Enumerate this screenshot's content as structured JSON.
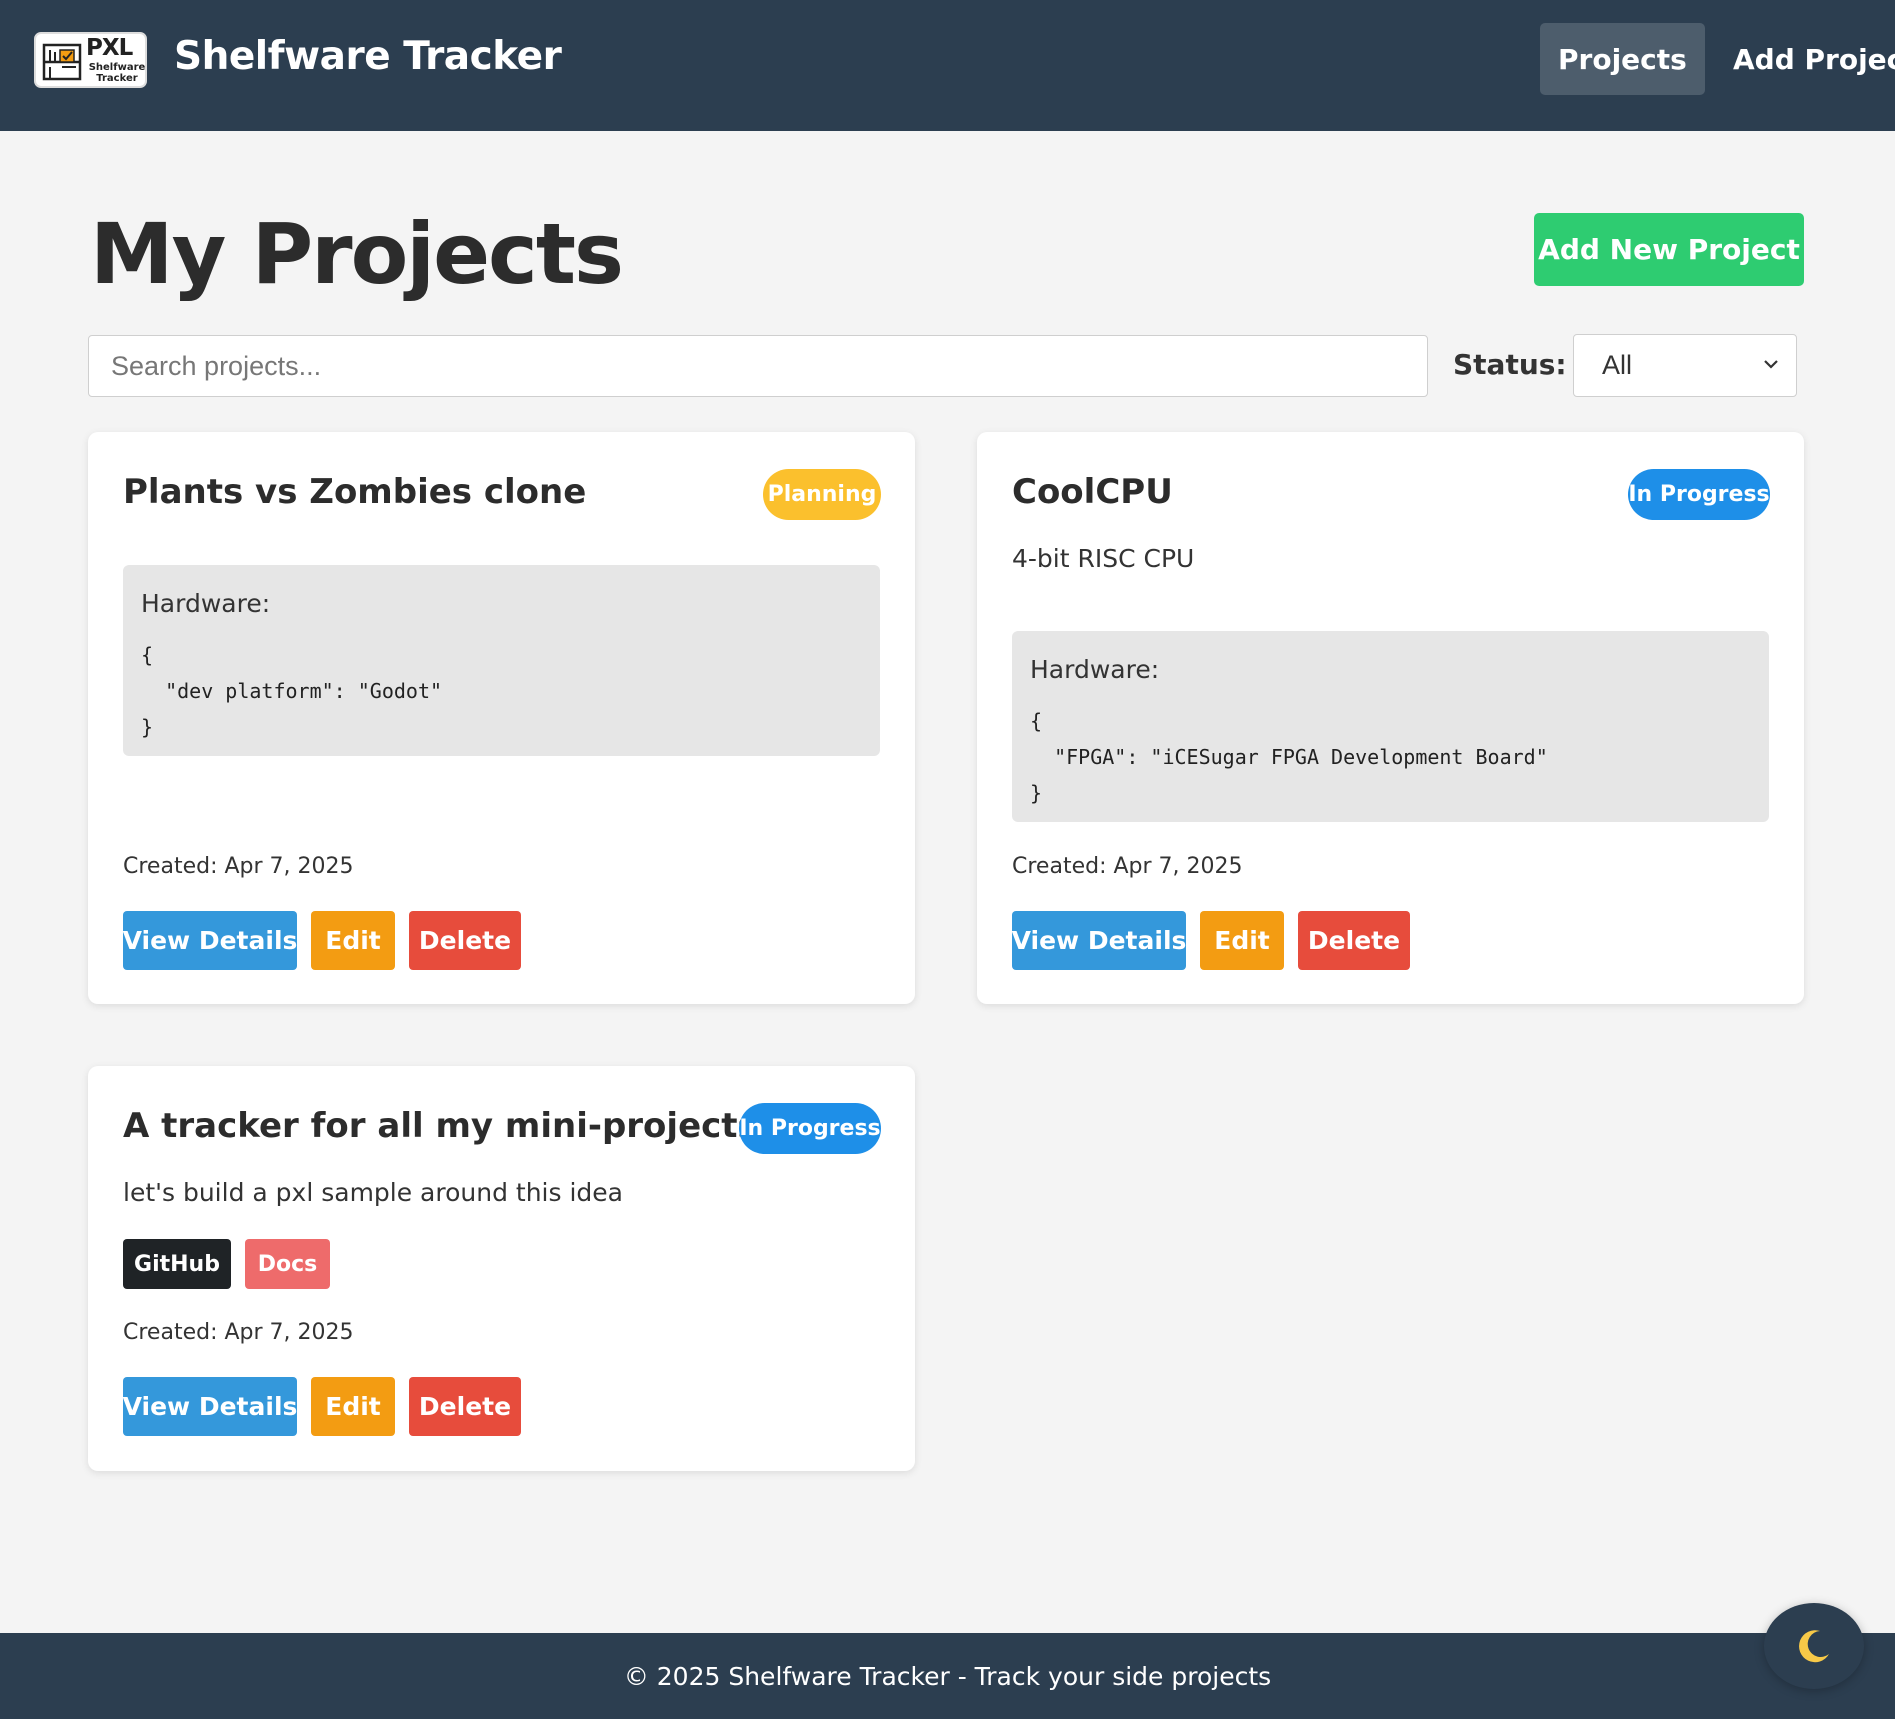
{
  "header": {
    "logo_text": "PXL",
    "logo_subtext_1": "Shelfware",
    "logo_subtext_2": "Tracker",
    "app_title": "Shelfware Tracker",
    "nav": [
      {
        "label": "Projects",
        "active": true
      },
      {
        "label": "Add Project",
        "active": false
      }
    ]
  },
  "main": {
    "title": "My Projects",
    "add_button": "Add New Project",
    "search_placeholder": "Search projects...",
    "status_label": "Status:",
    "status_selected": "All"
  },
  "projects": [
    {
      "title": "Plants vs Zombies clone",
      "status": "Planning",
      "status_color": "#fbc02d",
      "description": "",
      "hardware_label": "Hardware:",
      "hardware_code": "{\n  \"dev platform\": \"Godot\"\n}",
      "created": "Created: Apr 7, 2025",
      "buttons": {
        "view": "View Details",
        "edit": "Edit",
        "delete": "Delete"
      }
    },
    {
      "title": "CoolCPU",
      "status": "In Progress",
      "status_color": "#1e8fe8",
      "description": "4-bit RISC CPU",
      "hardware_label": "Hardware:",
      "hardware_code": "{\n  \"FPGA\": \"iCESugar FPGA Development Board\"\n}",
      "created": "Created: Apr 7, 2025",
      "buttons": {
        "view": "View Details",
        "edit": "Edit",
        "delete": "Delete"
      }
    },
    {
      "title": "A tracker for all my mini-projects",
      "status": "In Progress",
      "status_color": "#1e8fe8",
      "description": "let's build a pxl sample around this idea",
      "links": [
        "GitHub",
        "Docs"
      ],
      "created": "Created: Apr 7, 2025",
      "buttons": {
        "view": "View Details",
        "edit": "Edit",
        "delete": "Delete"
      }
    }
  ],
  "footer": {
    "text": "© 2025 Shelfware Tracker - Track your side projects"
  },
  "theme_toggle_icon": "moon-icon",
  "colors": {
    "header_bg": "#2c3e50",
    "primary_green": "#2ecc71",
    "view_blue": "#3498db",
    "edit_orange": "#f39c12",
    "delete_red": "#e74c3c"
  }
}
